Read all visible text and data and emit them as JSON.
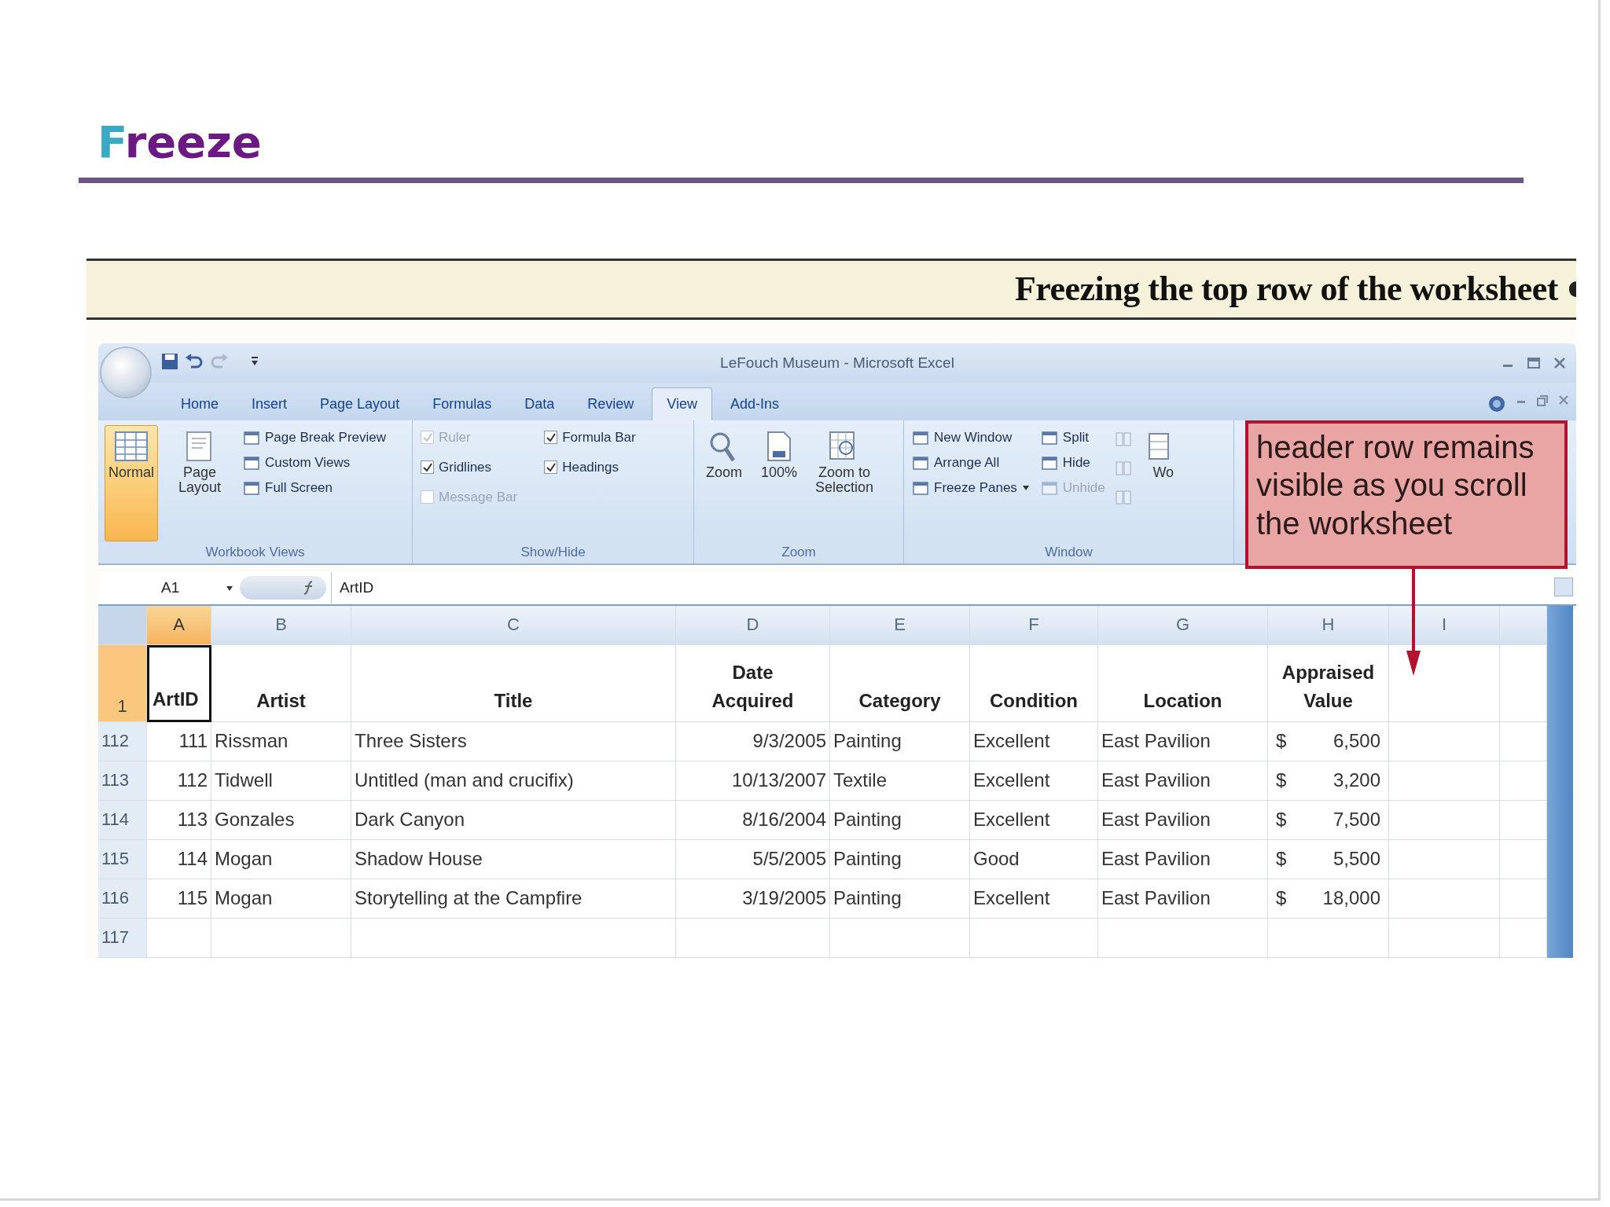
{
  "slide": {
    "title": "Freeze"
  },
  "figure": {
    "caption": "Freezing the top row of the worksheet"
  },
  "excel": {
    "window_title": "LeFouch Museum - Microsoft Excel",
    "tabs": [
      {
        "label": "Home",
        "selected": false
      },
      {
        "label": "Insert",
        "selected": false
      },
      {
        "label": "Page Layout",
        "selected": false
      },
      {
        "label": "Formulas",
        "selected": false
      },
      {
        "label": "Data",
        "selected": false
      },
      {
        "label": "Review",
        "selected": false
      },
      {
        "label": "View",
        "selected": true
      },
      {
        "label": "Add-Ins",
        "selected": false
      }
    ],
    "ribbon": [
      {
        "label": "Workbook Views",
        "items": [
          {
            "kind": "large",
            "label": "Normal",
            "selected": true
          },
          {
            "kind": "large",
            "label": "Page Layout",
            "selected": false
          },
          {
            "kind": "stack",
            "items": [
              {
                "label": "Page Break Preview",
                "disabled": false
              },
              {
                "label": "Custom Views",
                "disabled": false
              },
              {
                "label": "Full Screen",
                "disabled": false
              }
            ]
          }
        ]
      },
      {
        "label": "Show/Hide",
        "items": [
          {
            "kind": "checks",
            "items": [
              {
                "label": "Ruler",
                "checked": true,
                "disabled": true
              },
              {
                "label": "Gridlines",
                "checked": true,
                "disabled": false
              },
              {
                "label": "Message Bar",
                "checked": false,
                "disabled": true
              }
            ]
          },
          {
            "kind": "checks",
            "items": [
              {
                "label": "Formula Bar",
                "checked": true,
                "disabled": false
              },
              {
                "label": "Headings",
                "checked": true,
                "disabled": false
              }
            ]
          }
        ]
      },
      {
        "label": "Zoom",
        "items": [
          {
            "kind": "large",
            "label": "Zoom"
          },
          {
            "kind": "large",
            "label": "100%"
          },
          {
            "kind": "large",
            "label": "Zoom to Selection"
          }
        ]
      },
      {
        "label": "Window",
        "items": [
          {
            "kind": "stack",
            "items": [
              {
                "label": "New Window",
                "disabled": false
              },
              {
                "label": "Arrange All",
                "disabled": false
              },
              {
                "label": "Freeze Panes",
                "disabled": false,
                "dropdown": true
              }
            ]
          },
          {
            "kind": "stack",
            "items": [
              {
                "label": "Split",
                "disabled": false
              },
              {
                "label": "Hide",
                "disabled": false
              },
              {
                "label": "Unhide",
                "disabled": true
              }
            ]
          },
          {
            "kind": "icons"
          },
          {
            "kind": "large",
            "label": "Wo"
          }
        ]
      }
    ],
    "formula_bar": {
      "name_box": "A1",
      "formula": "ArtID"
    },
    "columns": [
      {
        "letter": "A",
        "selected": true,
        "kind": "number"
      },
      {
        "letter": "B",
        "selected": false,
        "kind": "text"
      },
      {
        "letter": "C",
        "selected": false,
        "kind": "text"
      },
      {
        "letter": "D",
        "selected": false,
        "kind": "date"
      },
      {
        "letter": "E",
        "selected": false,
        "kind": "text"
      },
      {
        "letter": "F",
        "selected": false,
        "kind": "text"
      },
      {
        "letter": "G",
        "selected": false,
        "kind": "text"
      },
      {
        "letter": "H",
        "selected": false,
        "kind": "currency"
      },
      {
        "letter": "I",
        "selected": false
      }
    ],
    "header_row": {
      "label": "1",
      "selected": true,
      "cells": [
        "ArtID",
        "Artist",
        "Title",
        "Date Acquired",
        "Category",
        "Condition",
        "Location",
        "Appraised Value"
      ]
    },
    "rows": [
      {
        "label": "112",
        "cells": [
          "111",
          "Rissman",
          "Three Sisters",
          "9/3/2005",
          "Painting",
          "Excellent",
          "East Pavilion",
          {
            "symbol": "$",
            "amount": "6,500"
          }
        ]
      },
      {
        "label": "113",
        "cells": [
          "112",
          "Tidwell",
          "Untitled (man and crucifix)",
          "10/13/2007",
          "Textile",
          "Excellent",
          "East Pavilion",
          {
            "symbol": "$",
            "amount": "3,200"
          }
        ]
      },
      {
        "label": "114",
        "cells": [
          "113",
          "Gonzales",
          "Dark Canyon",
          "8/16/2004",
          "Painting",
          "Excellent",
          "East Pavilion",
          {
            "symbol": "$",
            "amount": "7,500"
          }
        ]
      },
      {
        "label": "115",
        "cells": [
          "114",
          "Mogan",
          "Shadow House",
          "5/5/2005",
          "Painting",
          "Good",
          "East Pavilion",
          {
            "symbol": "$",
            "amount": "5,500"
          }
        ]
      },
      {
        "label": "116",
        "cells": [
          "115",
          "Mogan",
          "Storytelling at the Campfire",
          "3/19/2005",
          "Painting",
          "Excellent",
          "East Pavilion",
          {
            "symbol": "$",
            "amount": "18,000"
          }
        ]
      },
      {
        "label": "117"
      }
    ]
  },
  "callout": {
    "text": "header row remains visible as you scroll the worksheet"
  }
}
